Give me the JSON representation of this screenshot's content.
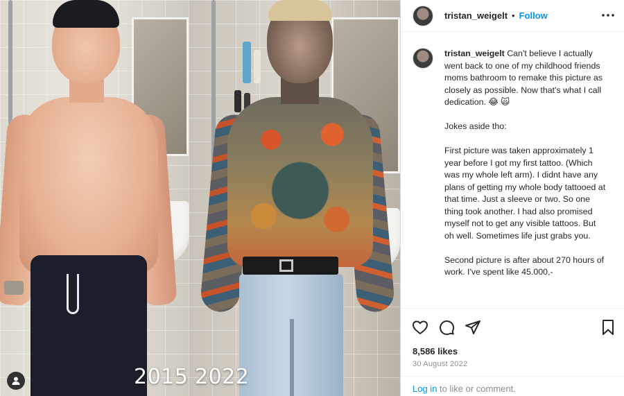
{
  "photo": {
    "year_left": "2015",
    "year_right": "2022",
    "tag_icon": "person-tag-icon"
  },
  "header": {
    "username": "tristan_weigelt",
    "separator": "•",
    "follow_label": "Follow",
    "more_icon": "more-options-icon"
  },
  "caption": {
    "username": "tristan_weigelt",
    "paragraphs": [
      "Can't believe I actually went back to one of my childhood friends moms bathroom to remake this picture as closely as possible. Now that's what I call dedication. 😂 🙀",
      "Jokes aside tho:",
      "First picture was taken approximately 1 year before I got my first tattoo. (Which was my whole left arm). I didnt have any plans of getting my whole body tattooed at that time. Just a sleeve or two. So one thing took another. I had also promised myself not to get any visible tattoos. But oh well. Sometimes life just grabs you.",
      "Second picture is after about 270 hours of work. I've spent like 45.000,-"
    ]
  },
  "actions": {
    "like_icon": "heart-icon",
    "comment_icon": "comment-icon",
    "share_icon": "share-icon",
    "save_icon": "bookmark-icon"
  },
  "stats": {
    "likes": "8,586 likes",
    "date": "30 August 2022"
  },
  "footer": {
    "login_label": "Log in",
    "rest_text": " to like or comment."
  },
  "colors": {
    "link_blue": "#0095f6",
    "text": "#262626",
    "muted": "#8e8e8e",
    "border": "#dbdbdb"
  }
}
